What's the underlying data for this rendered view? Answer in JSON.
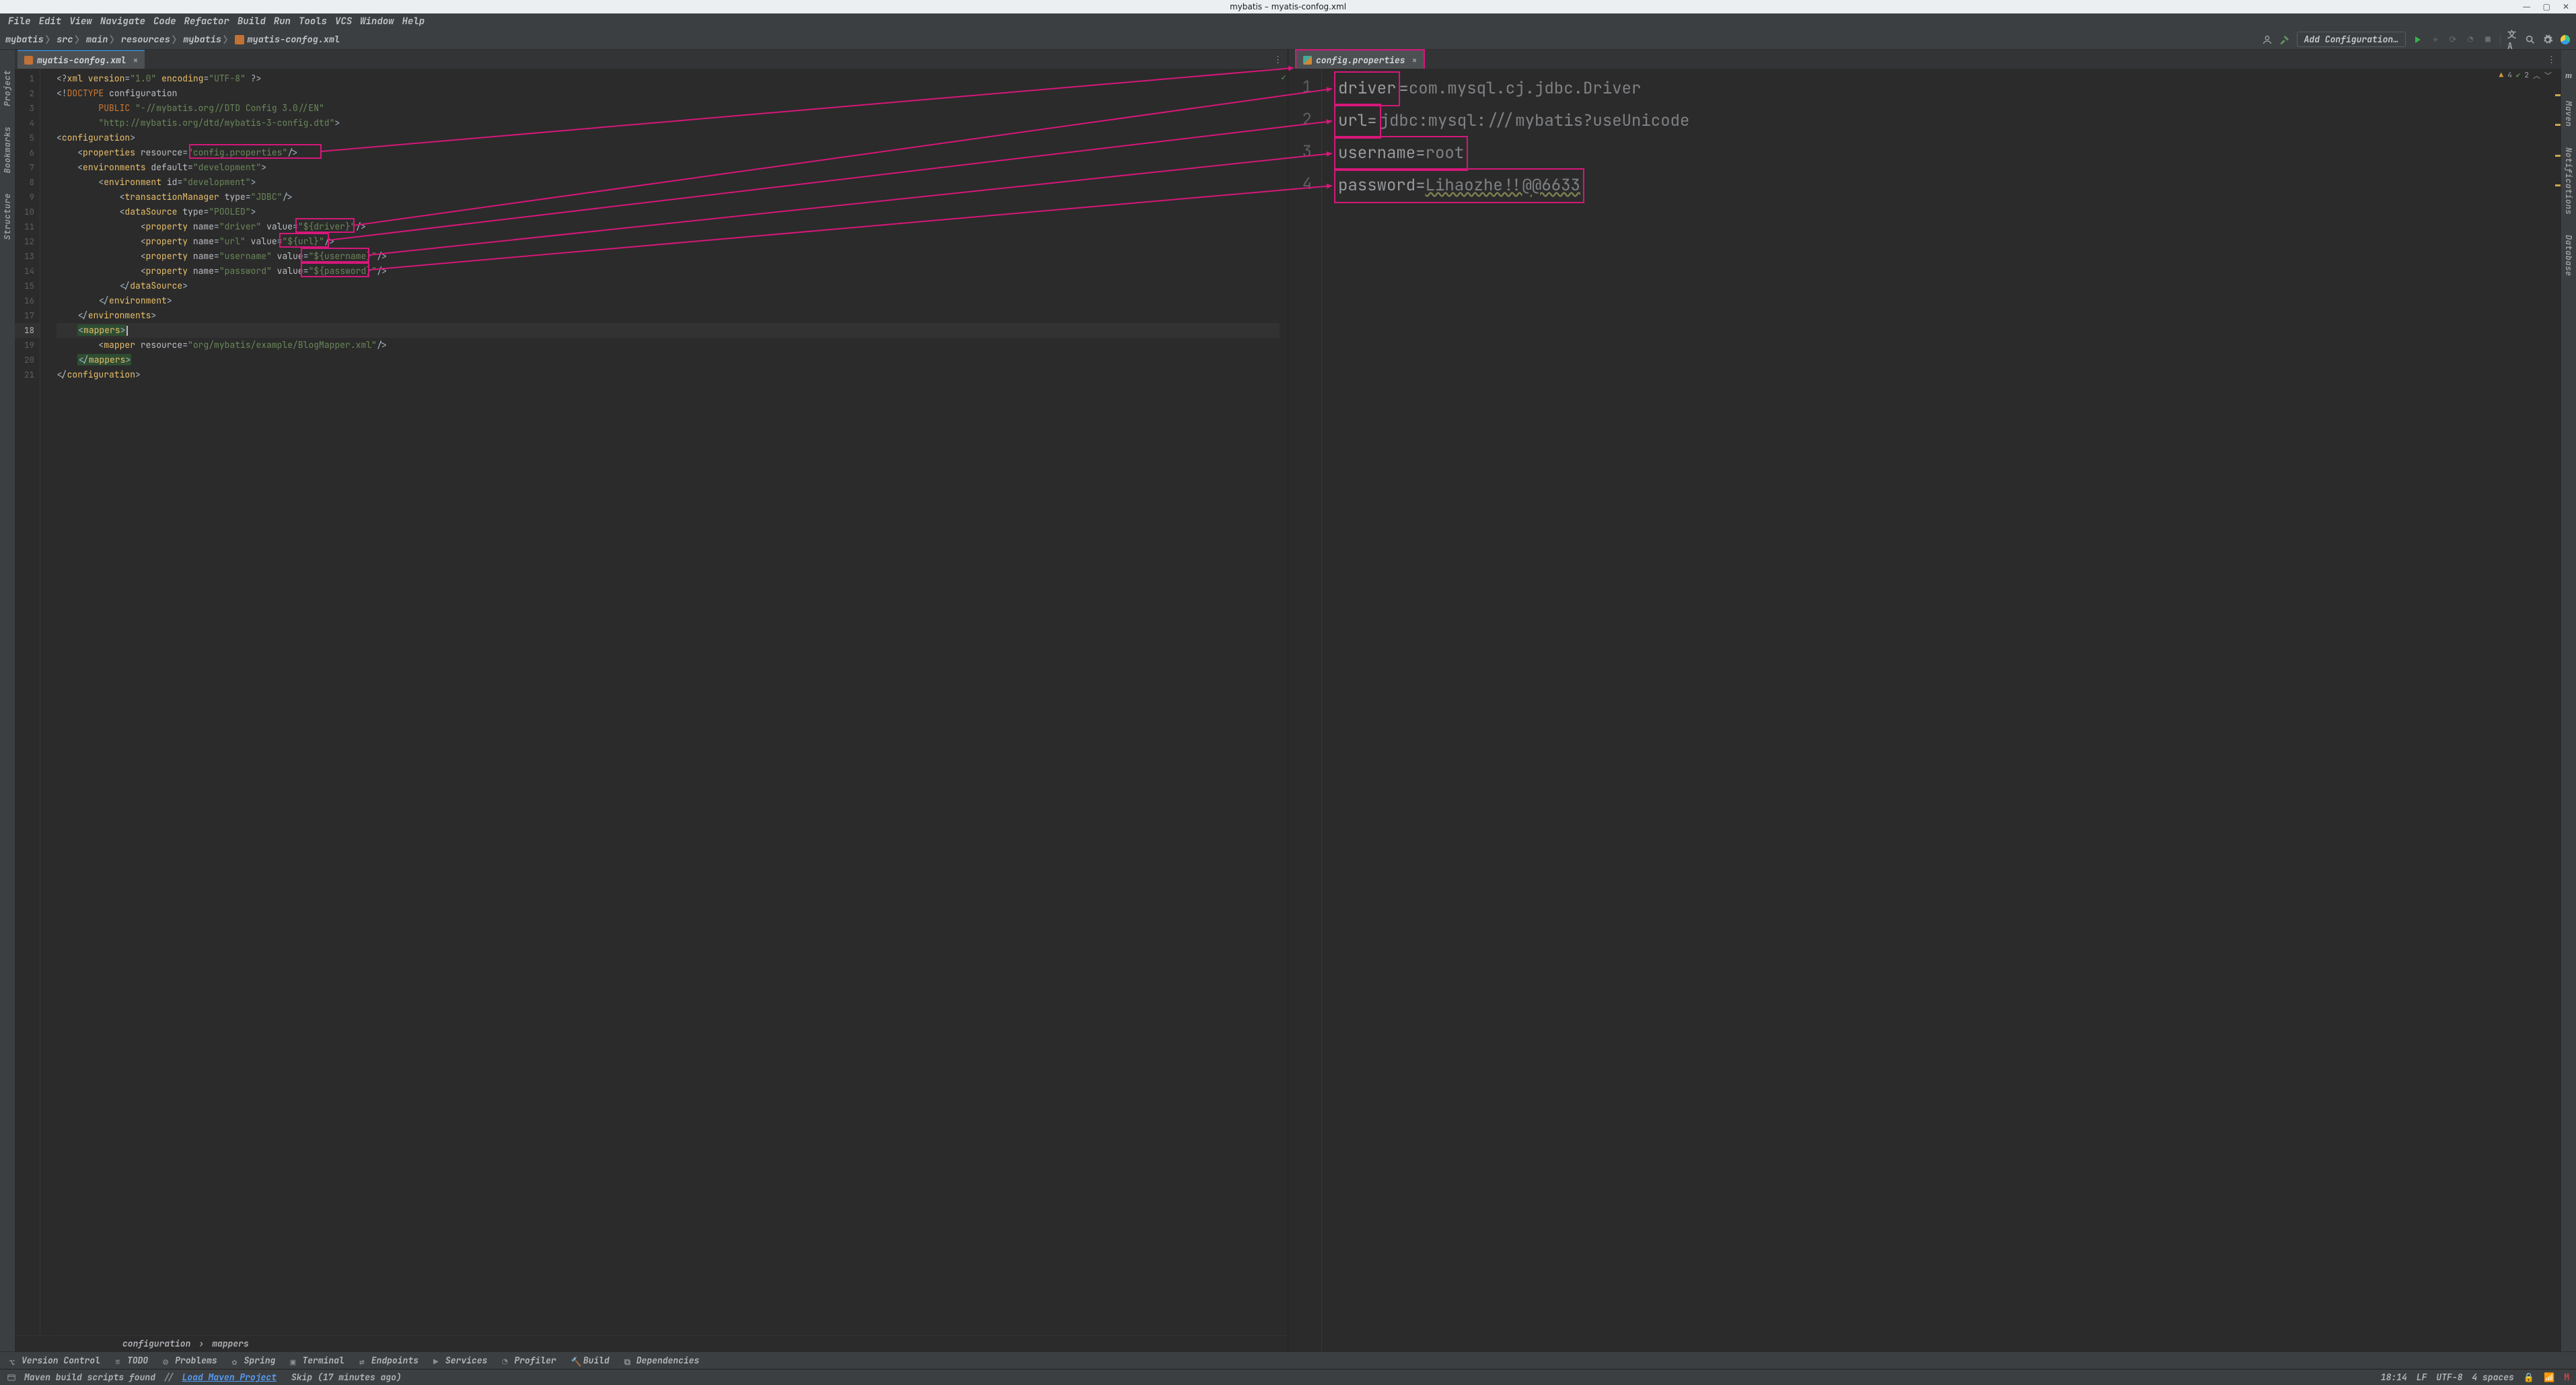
{
  "os_title": "mybatis – myatis-confog.xml",
  "menu": [
    "File",
    "Edit",
    "View",
    "Navigate",
    "Code",
    "Refactor",
    "Build",
    "Run",
    "Tools",
    "VCS",
    "Window",
    "Help"
  ],
  "breadcrumbs": [
    "mybatis",
    "src",
    "main",
    "resources",
    "mybatis",
    "myatis-confog.xml"
  ],
  "add_config_label": "Add Configuration…",
  "left_rail": [
    "Project",
    "Bookmarks",
    "Structure"
  ],
  "right_rail": [
    "Maven",
    "Notifications",
    "Database"
  ],
  "tab_left": "myatis-confog.xml",
  "tab_right": "config.properties",
  "xml_lines": [
    {
      "n": 1,
      "html": "<span class='pu'>&lt;?</span><span class='tg'>xml version</span><span class='pu'>=</span><span class='st'>\"1.0\"</span> <span class='tg'>encoding</span><span class='pu'>=</span><span class='st'>\"UTF-8\"</span> <span class='pu'>?&gt;</span>"
    },
    {
      "n": 2,
      "html": "<span class='pu'>&lt;!</span><span class='kw'>DOCTYPE</span> <span class='at'>configuration</span>"
    },
    {
      "n": 3,
      "html": "        <span class='kw'>PUBLIC</span> <span class='st'>\"-//mybatis.org//DTD Config 3.0//EN\"</span>"
    },
    {
      "n": 4,
      "html": "        <span class='st'>\"http://mybatis.org/dtd/mybatis-3-config.dtd\"</span><span class='pu'>&gt;</span>"
    },
    {
      "n": 5,
      "html": "<span class='pu'>&lt;</span><span class='tg'>configuration</span><span class='pu'>&gt;</span>"
    },
    {
      "n": 6,
      "html": "    <span class='pu'>&lt;</span><span class='tg'>properties </span><span class='at'>resource</span><span class='pu'>=</span><span class='st'>\"config.properties\"</span><span class='pu'>/&gt;</span>"
    },
    {
      "n": 7,
      "html": "    <span class='pu'>&lt;</span><span class='tg'>environments </span><span class='at'>default</span><span class='pu'>=</span><span class='st'>\"development\"</span><span class='pu'>&gt;</span>"
    },
    {
      "n": 8,
      "html": "        <span class='pu'>&lt;</span><span class='tg'>environment </span><span class='at'>id</span><span class='pu'>=</span><span class='st'>\"development\"</span><span class='pu'>&gt;</span>"
    },
    {
      "n": 9,
      "html": "            <span class='pu'>&lt;</span><span class='tg'>transactionManager </span><span class='at'>type</span><span class='pu'>=</span><span class='st'>\"JDBC\"</span><span class='pu'>/&gt;</span>"
    },
    {
      "n": 10,
      "html": "            <span class='pu'>&lt;</span><span class='tg'>dataSource </span><span class='at'>type</span><span class='pu'>=</span><span class='st'>\"POOLED\"</span><span class='pu'>&gt;</span>"
    },
    {
      "n": 11,
      "html": "                <span class='pu'>&lt;</span><span class='tg'>property </span><span class='at'>name</span><span class='pu'>=</span><span class='st'>\"driver\"</span> <span class='at'>value</span><span class='pu'>=</span><span class='st'>\"${driver}\"</span><span class='pu'>/&gt;</span>"
    },
    {
      "n": 12,
      "html": "                <span class='pu'>&lt;</span><span class='tg'>property </span><span class='at'>name</span><span class='pu'>=</span><span class='st'>\"url\"</span> <span class='at'>value</span><span class='pu'>=</span><span class='st'>\"${url}\"</span><span class='pu'>/&gt;</span>"
    },
    {
      "n": 13,
      "html": "                <span class='pu'>&lt;</span><span class='tg'>property </span><span class='at'>name</span><span class='pu'>=</span><span class='st'>\"username\"</span> <span class='at'>value</span><span class='pu'>=</span><span class='st'>\"${username}\"</span><span class='pu'>/&gt;</span>"
    },
    {
      "n": 14,
      "html": "                <span class='pu'>&lt;</span><span class='tg'>property </span><span class='at'>name</span><span class='pu'>=</span><span class='st'>\"password\"</span> <span class='at'>value</span><span class='pu'>=</span><span class='st'>\"${password}\"</span><span class='pu'>/&gt;</span>"
    },
    {
      "n": 15,
      "html": "            <span class='pu'>&lt;/</span><span class='tg'>dataSource</span><span class='pu'>&gt;</span>"
    },
    {
      "n": 16,
      "html": "        <span class='pu'>&lt;/</span><span class='tg'>environment</span><span class='pu'>&gt;</span>"
    },
    {
      "n": 17,
      "html": "    <span class='pu'>&lt;/</span><span class='tg'>environments</span><span class='pu'>&gt;</span>"
    },
    {
      "n": 18,
      "html": "    <span class='sel-bg'><span class='pu'>&lt;</span><span class='tg'>mappers</span><span class='pu'>&gt;</span></span><span class='caret'></span>",
      "cursor": true
    },
    {
      "n": 19,
      "html": "        <span class='pu'>&lt;</span><span class='tg'>mapper </span><span class='at'>resource</span><span class='pu'>=</span><span class='st'>\"org/mybatis/example/BlogMapper.xml\"</span><span class='pu'>/&gt;</span>"
    },
    {
      "n": 20,
      "html": "    <span class='sel-bg'><span class='pu'>&lt;/</span><span class='tg'>mappers</span><span class='pu'>&gt;</span></span>"
    },
    {
      "n": 21,
      "html": "<span class='pu'>&lt;/</span><span class='tg'>configuration</span><span class='pu'>&gt;</span>"
    }
  ],
  "xml_crumbs": [
    "configuration",
    "mappers"
  ],
  "prop_lines": [
    {
      "n": 1,
      "k": "driver",
      "sep": "=",
      "v": "com.mysql.cj.jdbc.Driver"
    },
    {
      "n": 2,
      "k": "url",
      "sep": "=",
      "v": "jdbc:mysql:///mybatis?useUnicode"
    },
    {
      "n": 3,
      "k": "username",
      "sep": "=",
      "v": "root"
    },
    {
      "n": 4,
      "k": "password",
      "sep": "=",
      "v": "Lihaozhe!!@@6633"
    }
  ],
  "inspections": {
    "warn": 4,
    "ok": 2
  },
  "bottom_tools": [
    "Version Control",
    "TODO",
    "Problems",
    "Spring",
    "Terminal",
    "Endpoints",
    "Services",
    "Profiler",
    "Build",
    "Dependencies"
  ],
  "status_left": {
    "msg": "Maven build scripts found",
    "sep": "//",
    "link": "Load Maven Project",
    "skip": "Skip (17 minutes ago)"
  },
  "status_right": {
    "time": "18:14",
    "le": "LF",
    "enc": "UTF-8",
    "indent": "4 spaces"
  }
}
